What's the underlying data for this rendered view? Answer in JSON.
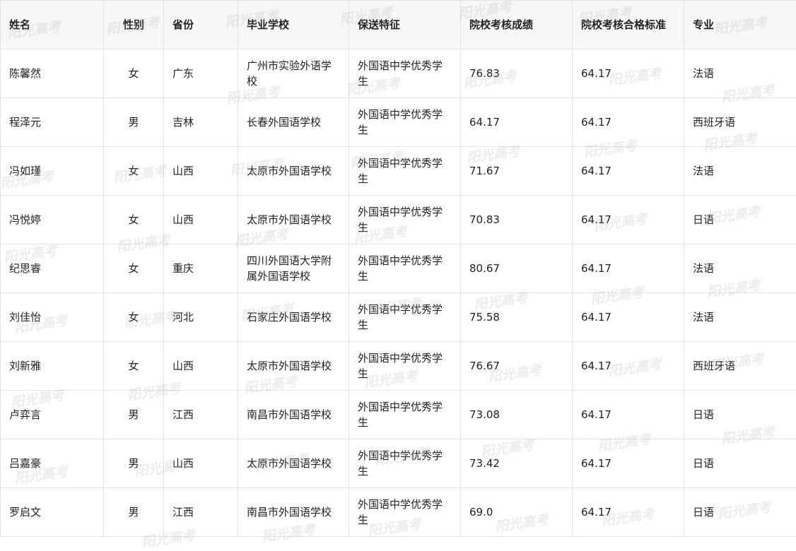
{
  "table": {
    "headers": [
      "姓名",
      "性别",
      "省份",
      "毕业学校",
      "保送特征",
      "院校考核成绩",
      "院校考核合格标准",
      "专业"
    ],
    "rows": [
      [
        "陈馨然",
        "女",
        "广东",
        "广州市实验外语学校",
        "外国语中学优秀学生",
        "76.83",
        "64.17",
        "法语"
      ],
      [
        "程泽元",
        "男",
        "吉林",
        "长春外国语学校",
        "外国语中学优秀学生",
        "64.17",
        "64.17",
        "西班牙语"
      ],
      [
        "冯如瑾",
        "女",
        "山西",
        "太原市外国语学校",
        "外国语中学优秀学生",
        "71.67",
        "64.17",
        "法语"
      ],
      [
        "冯悦婷",
        "女",
        "山西",
        "太原市外国语学校",
        "外国语中学优秀学生",
        "70.83",
        "64.17",
        "日语"
      ],
      [
        "纪思睿",
        "女",
        "重庆",
        "四川外国语大学附属外国语学校",
        "外国语中学优秀学生",
        "80.67",
        "64.17",
        "法语"
      ],
      [
        "刘佳怡",
        "女",
        "河北",
        "石家庄外国语学校",
        "外国语中学优秀学生",
        "75.58",
        "64.17",
        "法语"
      ],
      [
        "刘新雅",
        "女",
        "山西",
        "太原市外国语学校",
        "外国语中学优秀学生",
        "76.67",
        "64.17",
        "西班牙语"
      ],
      [
        "卢弈言",
        "男",
        "江西",
        "南昌市外国语学校",
        "外国语中学优秀学生",
        "73.08",
        "64.17",
        "日语"
      ],
      [
        "吕嘉豪",
        "男",
        "山西",
        "太原市外国语学校",
        "外国语中学优秀学生",
        "73.42",
        "64.17",
        "日语"
      ],
      [
        "罗启文",
        "男",
        "江西",
        "南昌市外国语学校",
        "外国语中学优秀学生",
        "69.0",
        "64.17",
        "日语"
      ]
    ]
  },
  "watermark": {
    "text": "阳光高考"
  }
}
